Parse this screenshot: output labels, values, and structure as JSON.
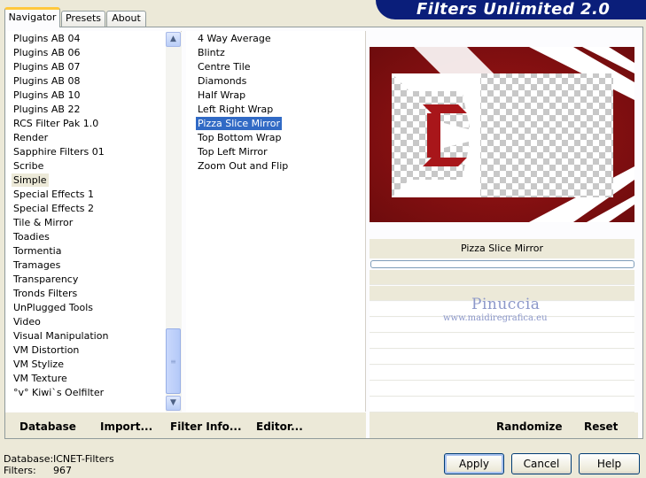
{
  "tabs": [
    {
      "label": "Navigator",
      "active": true
    },
    {
      "label": "Presets",
      "active": false
    },
    {
      "label": "About",
      "active": false
    }
  ],
  "banner": {
    "title": "Filters Unlimited 2.0"
  },
  "categories": {
    "items": [
      "Plugins AB 04",
      "Plugins AB 06",
      "Plugins AB 07",
      "Plugins AB 08",
      "Plugins AB 10",
      "Plugins AB 22",
      "RCS Filter Pak 1.0",
      "Render",
      "Sapphire Filters 01",
      "Scribe",
      "Simple",
      "Special Effects 1",
      "Special Effects 2",
      "Tile & Mirror",
      "Toadies",
      "Tormentia",
      "Tramages",
      "Transparency",
      "Tronds Filters",
      "UnPlugged Tools",
      "Video",
      "Visual Manipulation",
      "VM Distortion",
      "VM Stylize",
      "VM Texture",
      "°v° Kiwi`s Oelfilter"
    ],
    "selected": "Simple"
  },
  "filters": {
    "items": [
      "4 Way Average",
      "Blintz",
      "Centre Tile",
      "Diamonds",
      "Half Wrap",
      "Left Right Wrap",
      "Pizza Slice Mirror",
      "Top Bottom Wrap",
      "Top Left Mirror",
      "Zoom Out and Flip"
    ],
    "selected": "Pizza Slice Mirror"
  },
  "preview": {
    "filter_name": "Pizza Slice Mirror",
    "progress": 0
  },
  "watermark": {
    "line1": "Pinuccia",
    "line2": "www.maidiregrafica.eu"
  },
  "panel_buttons": {
    "database": "Database",
    "import": "Import...",
    "filter_info": "Filter Info...",
    "editor": "Editor...",
    "randomize": "Randomize",
    "reset": "Reset"
  },
  "footer": {
    "database_label": "Database:",
    "database_value": "ICNET-Filters",
    "filters_label": "Filters:",
    "filters_value": "967"
  },
  "dialog_buttons": {
    "apply": "Apply",
    "cancel": "Cancel",
    "help": "Help"
  },
  "colors": {
    "accent_blue": "#316ac5",
    "banner": "#0a1e7a",
    "preview_red": "#7d0f10"
  },
  "icons": {
    "scroll_up": "chevron-up-icon",
    "scroll_down": "chevron-down-icon",
    "thumb_grip": "grip-icon"
  }
}
